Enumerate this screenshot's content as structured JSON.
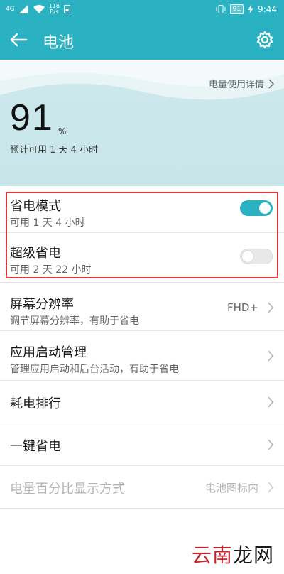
{
  "status_bar": {
    "signal": "4G",
    "speed_value": "118",
    "speed_unit": "B/s",
    "battery": "91",
    "time": "9:44"
  },
  "app_bar": {
    "title": "电池",
    "back_icon": "arrow-left-icon",
    "settings_icon": "gear-icon"
  },
  "hero": {
    "detail_link": "电量使用详情",
    "percent": "91",
    "percent_unit": "%",
    "estimate": "预计可用 1 天 4 小时"
  },
  "list": {
    "power_saving": {
      "title": "省电模式",
      "sub": "可用 1 天 4 小时",
      "enabled": true
    },
    "ultra_saving": {
      "title": "超级省电",
      "sub": "可用 2 天 22 小时",
      "enabled": false
    },
    "resolution": {
      "title": "屏幕分辨率",
      "sub": "调节屏幕分辨率，有助于省电",
      "value": "FHD+"
    },
    "app_launch": {
      "title": "应用启动管理",
      "sub": "管理应用启动和后台活动，有助于省电"
    },
    "ranking": {
      "title": "耗电排行"
    },
    "one_key": {
      "title": "一键省电"
    },
    "percent_display": {
      "title": "电量百分比显示方式",
      "value": "电池图标内"
    }
  },
  "watermark": {
    "red": "云南",
    "black": "龙网"
  },
  "colors": {
    "accent": "#2bb2c2",
    "highlight": "#e03a3a",
    "hero_bg": "#cde8ec"
  }
}
